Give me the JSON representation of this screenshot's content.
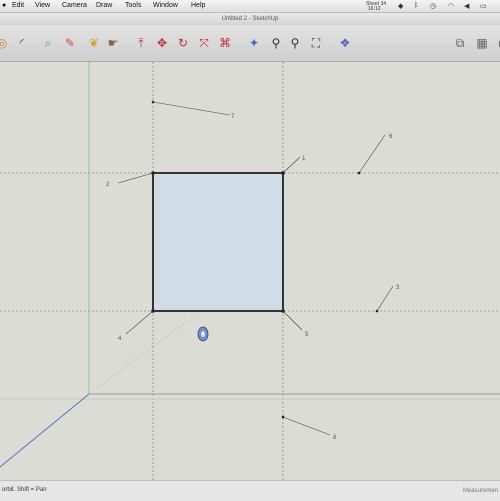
{
  "menubar": {
    "items": [
      "Edit",
      "View",
      "Camera",
      "Draw",
      "Tools",
      "Window",
      "Help"
    ],
    "clock": [
      "Sheet 34",
      "16:12"
    ]
  },
  "window": {
    "title": "Untitled 2 - SketchUp"
  },
  "toolbar": {
    "tools": [
      {
        "name": "orbit-icon",
        "glyph": "◎",
        "color": "#c98b2b"
      },
      {
        "name": "arc-icon",
        "glyph": "◜",
        "color": "#555"
      },
      {
        "name": "search-icon",
        "glyph": "⌕",
        "color": "#5a8fd0"
      },
      {
        "name": "pencil-icon",
        "glyph": "✎",
        "color": "#d04a4a"
      },
      {
        "name": "paint-bucket-icon",
        "glyph": "❦",
        "color": "#e0a020"
      },
      {
        "name": "hand-icon",
        "glyph": "☛",
        "color": "#8a6a3a"
      },
      {
        "name": "push-pull-icon",
        "glyph": "⤒",
        "color": "#c03030"
      },
      {
        "name": "move-icon",
        "glyph": "✥",
        "color": "#c03030"
      },
      {
        "name": "rotate-icon",
        "glyph": "↻",
        "color": "#c03030"
      },
      {
        "name": "scale-icon",
        "glyph": "⤧",
        "color": "#c03030"
      },
      {
        "name": "offset-icon",
        "glyph": "⌘",
        "color": "#c03030"
      },
      {
        "name": "select-icon",
        "glyph": "✦",
        "color": "#3a6fc0"
      },
      {
        "name": "zoom-icon",
        "glyph": "⚲",
        "color": "#333"
      },
      {
        "name": "zoom-extents-icon",
        "glyph": "⛶",
        "color": "#333"
      },
      {
        "name": "components-icon",
        "glyph": "❖",
        "color": "#5560c0"
      },
      {
        "name": "shadows-icon",
        "glyph": "⧉",
        "color": "#666"
      },
      {
        "name": "sections-icon",
        "glyph": "▦",
        "color": "#666"
      }
    ]
  },
  "viewport": {
    "labels": [
      "1",
      "2",
      "3",
      "4",
      "5",
      "6",
      "7",
      "8"
    ],
    "face_color": "#cfdde6",
    "background": "#dcdcd6"
  },
  "status": {
    "hint": "orbit. Shift = Pan",
    "measurements_label": "Measuremen"
  }
}
